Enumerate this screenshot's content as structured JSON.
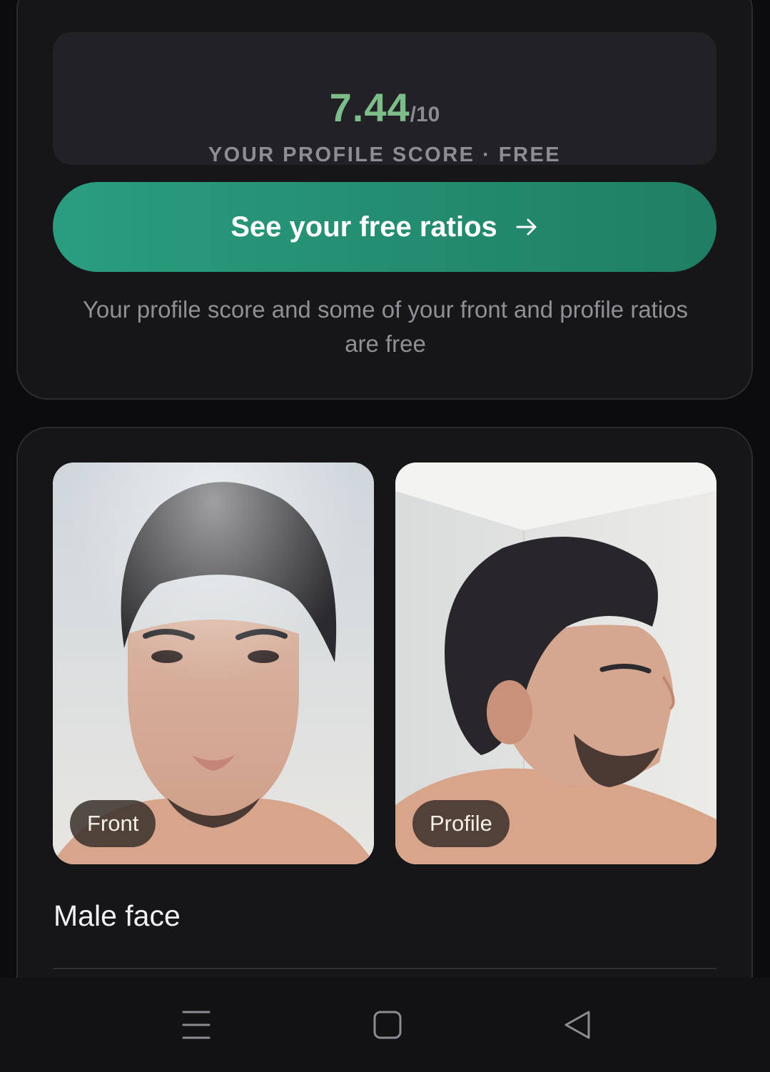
{
  "score": {
    "value": "7.44",
    "max": "/10",
    "caption": "YOUR PROFILE SCORE · FREE",
    "value_color": "#7dbd8a"
  },
  "cta": {
    "label": "See your free ratios",
    "icon": "arrow-right-icon",
    "color": "#2a9d80"
  },
  "note": "Your profile score and some of your front and profile ratios are free",
  "photos": {
    "front": {
      "label": "Front"
    },
    "profile": {
      "label": "Profile"
    }
  },
  "section": {
    "title": "Male face"
  },
  "navbar": {
    "icons": [
      "menu-icon",
      "home-square-icon",
      "back-triangle-icon"
    ]
  }
}
